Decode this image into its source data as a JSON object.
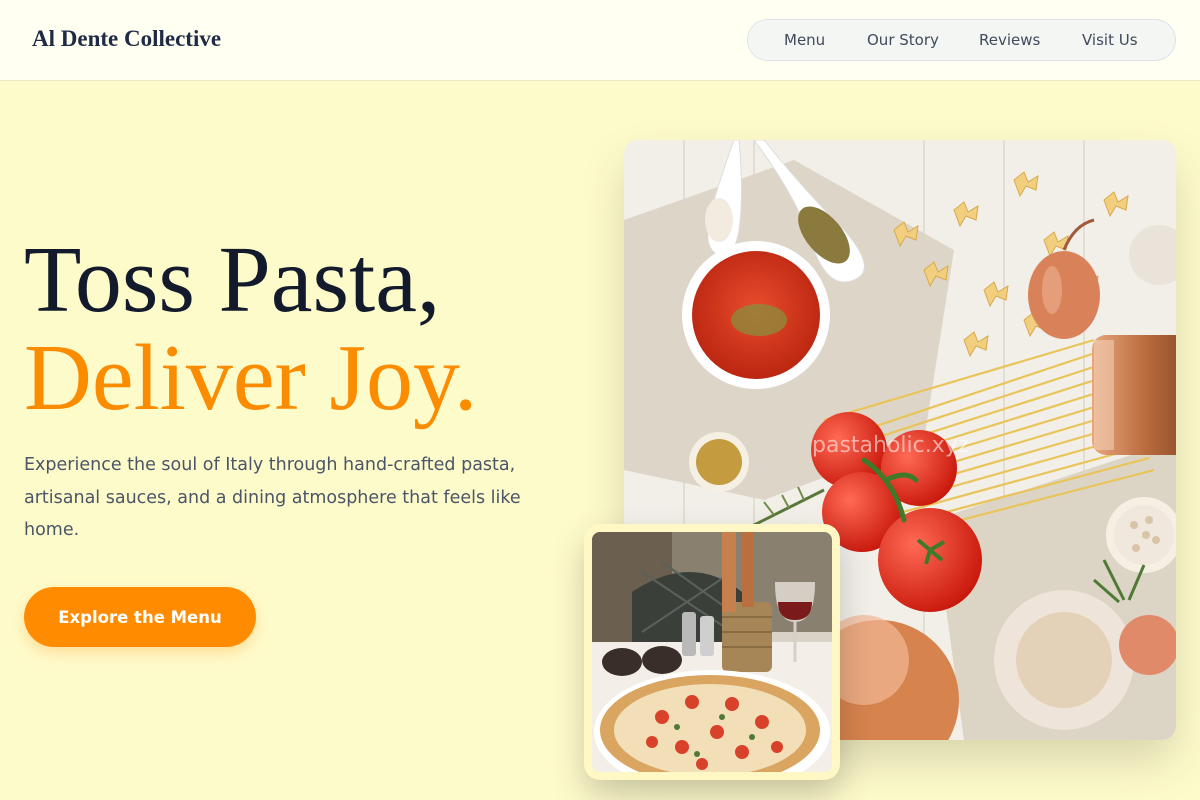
{
  "header": {
    "brand": "Al Dente Collective",
    "nav": [
      {
        "label": "Menu"
      },
      {
        "label": "Our Story"
      },
      {
        "label": "Reviews"
      },
      {
        "label": "Visit Us"
      }
    ]
  },
  "hero": {
    "title_line1": "Toss Pasta,",
    "title_line2": "Deliver Joy.",
    "description": "Experience the soul of Italy through hand-crafted pasta, artisanal sauces, and a dining atmosphere that feels like home.",
    "cta_label": "Explore the Menu"
  },
  "images": {
    "main_watermark": "pastaholic.xyz"
  },
  "colors": {
    "background": "#fefbcb",
    "accent": "#ff8c00",
    "heading": "#121a2b"
  }
}
